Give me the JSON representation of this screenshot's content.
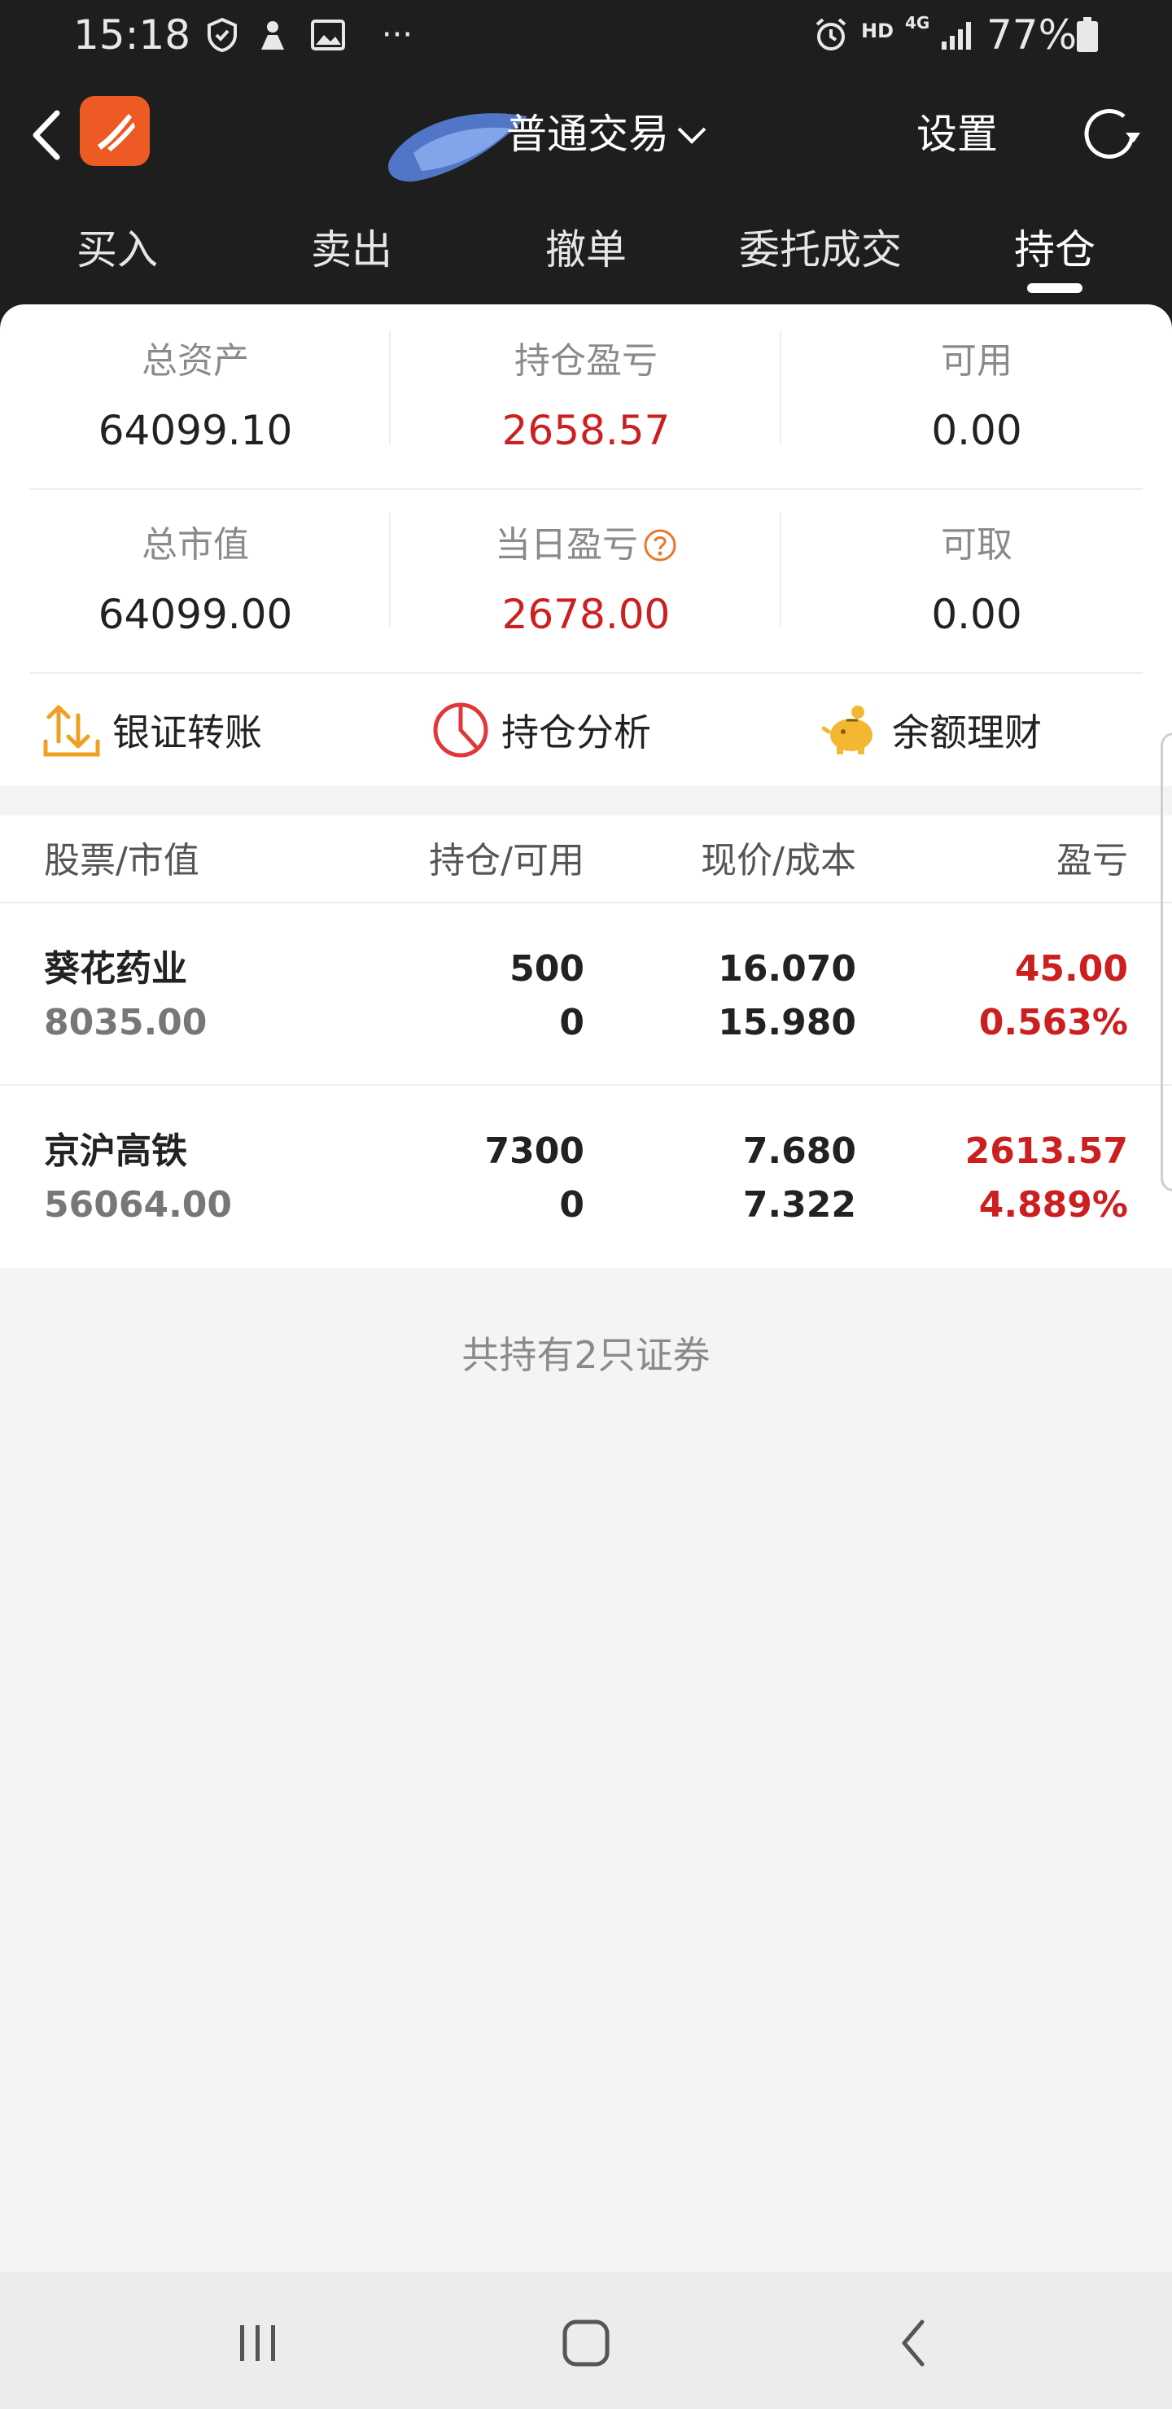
{
  "status_bar": {
    "time": "15:18",
    "more_dots": "···",
    "hd_label": "HD",
    "network_label": "4G",
    "battery_text": "77%"
  },
  "nav": {
    "title": "普通交易",
    "settings_label": "设置"
  },
  "tabs": [
    {
      "label": "买入"
    },
    {
      "label": "卖出"
    },
    {
      "label": "撤单"
    },
    {
      "label": "委托成交"
    },
    {
      "label": "持仓",
      "active": true
    }
  ],
  "summary": {
    "total_assets": {
      "label": "总资产",
      "value": "64099.10"
    },
    "position_pnl": {
      "label": "持仓盈亏",
      "value": "2658.57"
    },
    "available": {
      "label": "可用",
      "value": "0.00"
    },
    "total_market_value": {
      "label": "总市值",
      "value": "64099.00"
    },
    "daily_pnl": {
      "label": "当日盈亏",
      "value": "2678.00"
    },
    "withdrawable": {
      "label": "可取",
      "value": "0.00"
    }
  },
  "quick_actions": [
    {
      "label": "银证转账",
      "icon": "bank-transfer-icon"
    },
    {
      "label": "持仓分析",
      "icon": "pie-chart-icon"
    },
    {
      "label": "余额理财",
      "icon": "piggy-bank-icon"
    }
  ],
  "holdings": {
    "headers": [
      "股票/市值",
      "持仓/可用",
      "现价/成本",
      "盈亏"
    ],
    "rows": [
      {
        "name": "葵花药业",
        "market_value": "8035.00",
        "position": "500",
        "available": "0",
        "price": "16.070",
        "cost": "15.980",
        "pnl": "45.00",
        "pnl_pct": "0.563%"
      },
      {
        "name": "京沪高铁",
        "market_value": "56064.00",
        "position": "7300",
        "available": "0",
        "price": "7.680",
        "cost": "7.322",
        "pnl": "2613.57",
        "pnl_pct": "4.889%"
      }
    ],
    "count_text": "共持有2只证券"
  },
  "colors": {
    "header_bg": "#1e1e1e",
    "profit_red": "#cc1f1f",
    "brand_orange": "#ee5a24",
    "accent_orange": "#f0a020",
    "page_bg": "#f3f4f6"
  }
}
